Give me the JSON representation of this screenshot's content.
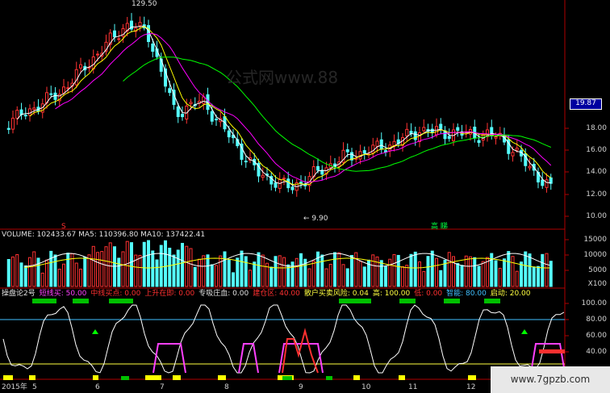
{
  "price_panel": {
    "high_label": "129.50",
    "low_label": "9.90",
    "current_price": "19.87",
    "axis_ticks": [
      "18.00",
      "16.00",
      "14.00",
      "12.00",
      "10.00"
    ],
    "sell_marker": "S",
    "sell_marker_color": "#ff3030",
    "chart_data": {
      "type": "candlestick",
      "y_axis_ticks": [
        18,
        16,
        14,
        12,
        10
      ],
      "high_label": 129.5,
      "low_label": 9.9,
      "last_price": 19.87
    }
  },
  "annotation_gaoni": "高 睇",
  "volume_panel": {
    "header": "VOLUME: 102433.67  MA5: 110396.80  MA10: 137422.41",
    "axis_ticks": [
      "15000",
      "10000",
      "5000"
    ],
    "axis_unit": "X100"
  },
  "indicator_panel": {
    "items": [
      {
        "text": "操盘论2号",
        "color": "#e0e0e0"
      },
      {
        "text": "短线买: 50.00",
        "color": "#ff40ff"
      },
      {
        "text": "中线买点: 0.00",
        "color": "#ff3030"
      },
      {
        "text": "上升在即: 0.00",
        "color": "#ff3030"
      },
      {
        "text": "专吸庄血: 0.00",
        "color": "#e0e0e0"
      },
      {
        "text": "建仓区: 40.00",
        "color": "#ff3030"
      },
      {
        "text": "散户买卖风险: 0.04",
        "color": "#ffff40"
      },
      {
        "text": "高: 100.00",
        "color": "#ffff40"
      },
      {
        "text": "低: 0.00",
        "color": "#ff3030"
      },
      {
        "text": "智能: 80.00",
        "color": "#40c0ff"
      },
      {
        "text": "启动: 20.00",
        "color": "#ffff40"
      }
    ],
    "axis_ticks": [
      "100.00",
      "80.00",
      "60.00",
      "40.00"
    ]
  },
  "time_axis": {
    "labels": [
      "2015年",
      "5",
      "6",
      "7",
      "8",
      "9",
      "10",
      "11",
      "12"
    ]
  },
  "watermark_top": "公式网www.88",
  "watermark_bottom": "www.7gpzb.com",
  "colors": {
    "up": "#ff3232",
    "down": "#54fcfc",
    "ma5": "#ffffff",
    "ma10": "#ffff00",
    "ma20": "#ff00ff",
    "ma60": "#00ff00"
  }
}
